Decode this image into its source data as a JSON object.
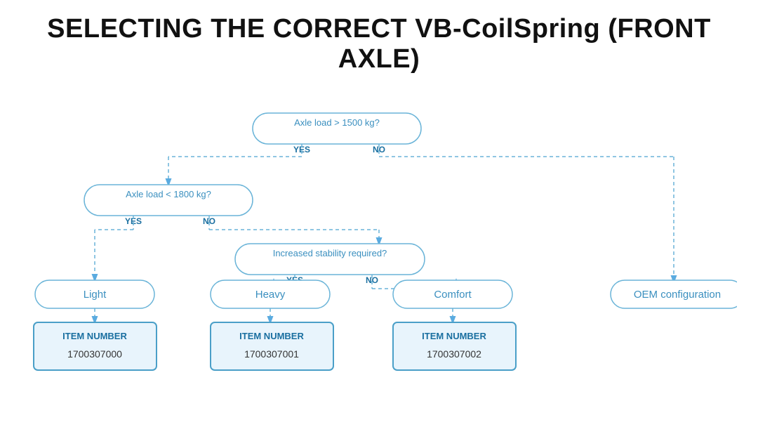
{
  "title": "SELECTING THE CORRECT VB-CoilSpring (FRONT AXLE)",
  "diagram": {
    "nodes": {
      "axle_load_1500": "Axle load > 1500 kg?",
      "axle_load_1800": "Axle load < 1800 kg?",
      "stability": "Increased stability required?",
      "light": "Light",
      "heavy": "Heavy",
      "comfort": "Comfort",
      "oem": "OEM configuration",
      "item_0_label": "ITEM NUMBER",
      "item_0_value": "1700307000",
      "item_1_label": "ITEM NUMBER",
      "item_1_value": "1700307001",
      "item_2_label": "ITEM NUMBER",
      "item_2_value": "1700307002"
    },
    "labels": {
      "yes": "YES",
      "no": "NO"
    }
  }
}
